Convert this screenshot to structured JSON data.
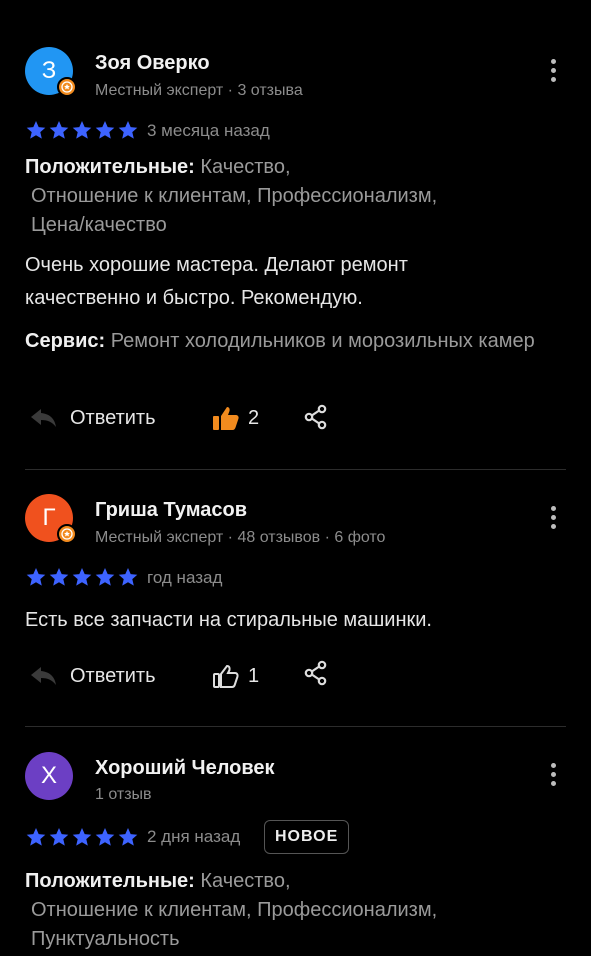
{
  "colors": {
    "star": "#3d63ff",
    "like_active": "#f28b1e"
  },
  "reviews": [
    {
      "avatar_letter": "З",
      "avatar_color": "#2196f3",
      "name": "Зоя Оверко",
      "meta": "Местный эксперт · 3 отзыва",
      "rating": 5,
      "date": "3 месяца назад",
      "positive_label": "Положительные:",
      "positive_line1": "Качество,",
      "positive_line2": "Отношение к клиентам, Профессионализм,",
      "positive_line3": "Цена/качество",
      "text": "Очень хорошие мастера. Делают ремонт качественно и быстро. Рекомендую.",
      "service_label": "Сервис:",
      "service_value": "Ремонт холодильников и морозильных камер",
      "reply_label": "Ответить",
      "likes": "2",
      "liked": true
    },
    {
      "avatar_letter": "Г",
      "avatar_color": "#f0511e",
      "name": "Гриша Тумасов",
      "meta": "Местный эксперт · 48 отзывов · 6 фото",
      "rating": 5,
      "date": "год назад",
      "text": "Есть все запчасти на стиральные машинки.",
      "reply_label": "Ответить",
      "likes": "1",
      "liked": false
    },
    {
      "avatar_letter": "Х",
      "avatar_color": "#6c3fc4",
      "name": "Хороший Человек",
      "meta": "1 отзыв",
      "rating": 5,
      "date": "2 дня назад",
      "badge": "НОВОЕ",
      "positive_label": "Положительные:",
      "positive_line1": "Качество,",
      "positive_line2": "Отношение к клиентам, Профессионализм,",
      "positive_line3": "Пунктуальность"
    }
  ]
}
